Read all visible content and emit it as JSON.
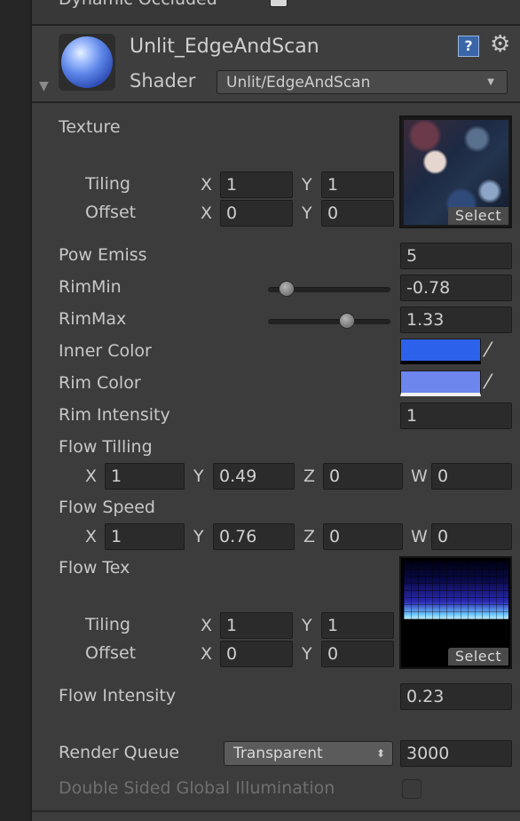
{
  "top": {
    "label": "Dynamic Occluded"
  },
  "material": {
    "name": "Unlit_EdgeAndScan",
    "shader_label": "Shader",
    "shader_value": "Unlit/EdgeAndScan"
  },
  "texture": {
    "label": "Texture",
    "tiling_label": "Tiling",
    "offset_label": "Offset",
    "x_label": "X",
    "y_label": "Y",
    "tiling_x": "1",
    "tiling_y": "1",
    "offset_x": "0",
    "offset_y": "0",
    "select_label": "Select"
  },
  "pow_emiss": {
    "label": "Pow Emiss",
    "value": "5"
  },
  "rim_min": {
    "label": "RimMin",
    "value": "-0.78",
    "slider_fraction": 0.15
  },
  "rim_max": {
    "label": "RimMax",
    "value": "1.33",
    "slider_fraction": 0.66
  },
  "inner_color": {
    "label": "Inner Color",
    "color": "#2c61ec"
  },
  "rim_color": {
    "label": "Rim Color",
    "color": "#6c86ee"
  },
  "rim_intensity": {
    "label": "Rim Intensity",
    "value": "1"
  },
  "flow_tilling": {
    "label": "Flow Tilling",
    "x_label": "X",
    "y_label": "Y",
    "z_label": "Z",
    "w_label": "W",
    "x": "1",
    "y": "0.49",
    "z": "0",
    "w": "0"
  },
  "flow_speed": {
    "label": "Flow Speed",
    "x_label": "X",
    "y_label": "Y",
    "z_label": "Z",
    "w_label": "W",
    "x": "1",
    "y": "0.76",
    "z": "0",
    "w": "0"
  },
  "flow_tex": {
    "label": "Flow Tex",
    "tiling_label": "Tiling",
    "offset_label": "Offset",
    "x_label": "X",
    "y_label": "Y",
    "tiling_x": "1",
    "tiling_y": "1",
    "offset_x": "0",
    "offset_y": "0",
    "select_label": "Select"
  },
  "flow_intensity": {
    "label": "Flow Intensity",
    "value": "0.23"
  },
  "render_queue": {
    "label": "Render Queue",
    "mode": "Transparent",
    "value": "3000"
  },
  "double_sided_gi": {
    "label": "Double Sided Global Illumination",
    "checked": false
  },
  "icons": {
    "help": "help-book-icon",
    "settings": "gear-icon",
    "foldout": "foldout-arrow-icon",
    "eyedropper": "eyedropper-icon",
    "dropdown": "dropdown-arrow-icon"
  }
}
